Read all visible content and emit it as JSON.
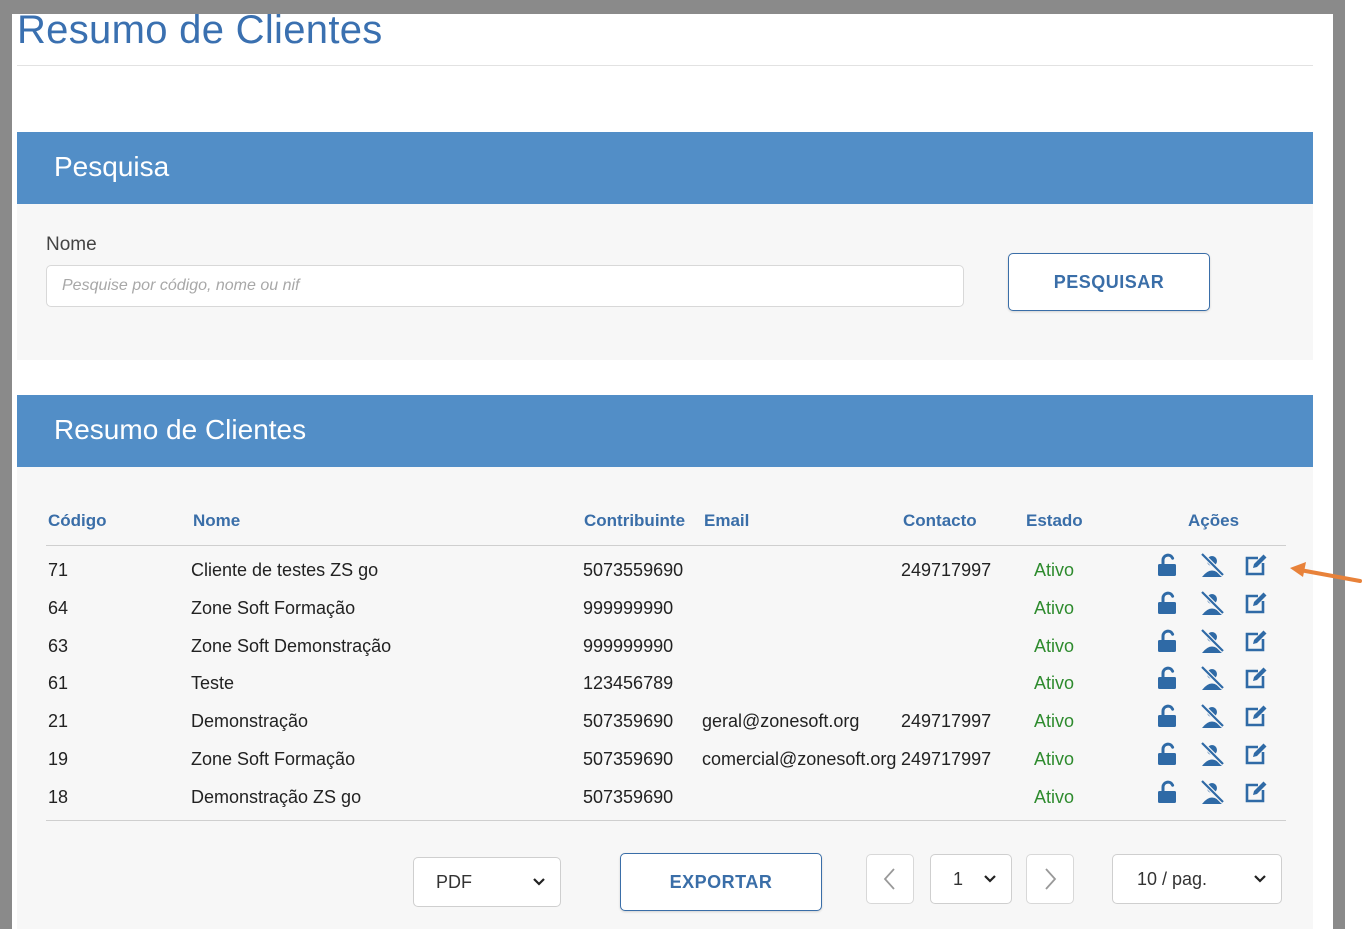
{
  "page": {
    "title": "Resumo de Clientes"
  },
  "search": {
    "header": "Pesquisa",
    "label": "Nome",
    "placeholder": "Pesquise por código, nome ou nif",
    "button_label": "PESQUISAR"
  },
  "summary": {
    "header": "Resumo de Clientes",
    "columns": {
      "codigo": "Código",
      "nome": "Nome",
      "contribuinte": "Contribuinte",
      "email": "Email",
      "contacto": "Contacto",
      "estado": "Estado",
      "acoes": "Ações"
    },
    "rows": [
      {
        "codigo": "71",
        "nome": "Cliente de testes ZS go",
        "contribuinte": "5073559690",
        "email": "",
        "contacto": "249717997",
        "estado": "Ativo"
      },
      {
        "codigo": "64",
        "nome": "Zone Soft Formação",
        "contribuinte": "999999990",
        "email": "",
        "contacto": "",
        "estado": "Ativo"
      },
      {
        "codigo": "63",
        "nome": "Zone Soft Demonstração",
        "contribuinte": "999999990",
        "email": "",
        "contacto": "",
        "estado": "Ativo"
      },
      {
        "codigo": "61",
        "nome": "Teste",
        "contribuinte": "123456789",
        "email": "",
        "contacto": "",
        "estado": "Ativo"
      },
      {
        "codigo": "21",
        "nome": "Demonstração",
        "contribuinte": "507359690",
        "email": "geral@zonesoft.org",
        "contacto": "249717997",
        "estado": "Ativo"
      },
      {
        "codigo": "19",
        "nome": "Zone Soft Formação",
        "contribuinte": "507359690",
        "email": "comercial@zonesoft.org",
        "contacto": "249717997",
        "estado": "Ativo"
      },
      {
        "codigo": "18",
        "nome": "Demonstração ZS go",
        "contribuinte": "507359690",
        "email": "",
        "contacto": "",
        "estado": "Ativo"
      }
    ],
    "action_icons": [
      "unlock-icon",
      "user-block-icon",
      "edit-icon"
    ]
  },
  "footer": {
    "export_format": "PDF",
    "export_label": "EXPORTAR",
    "page_number": "1",
    "per_page": "10 / pag."
  },
  "colors": {
    "accent": "#528ec7",
    "title": "#3a70b0",
    "link": "#3a6ea8",
    "status_active": "#2e8b2e",
    "annotation_arrow": "#e8823a"
  }
}
